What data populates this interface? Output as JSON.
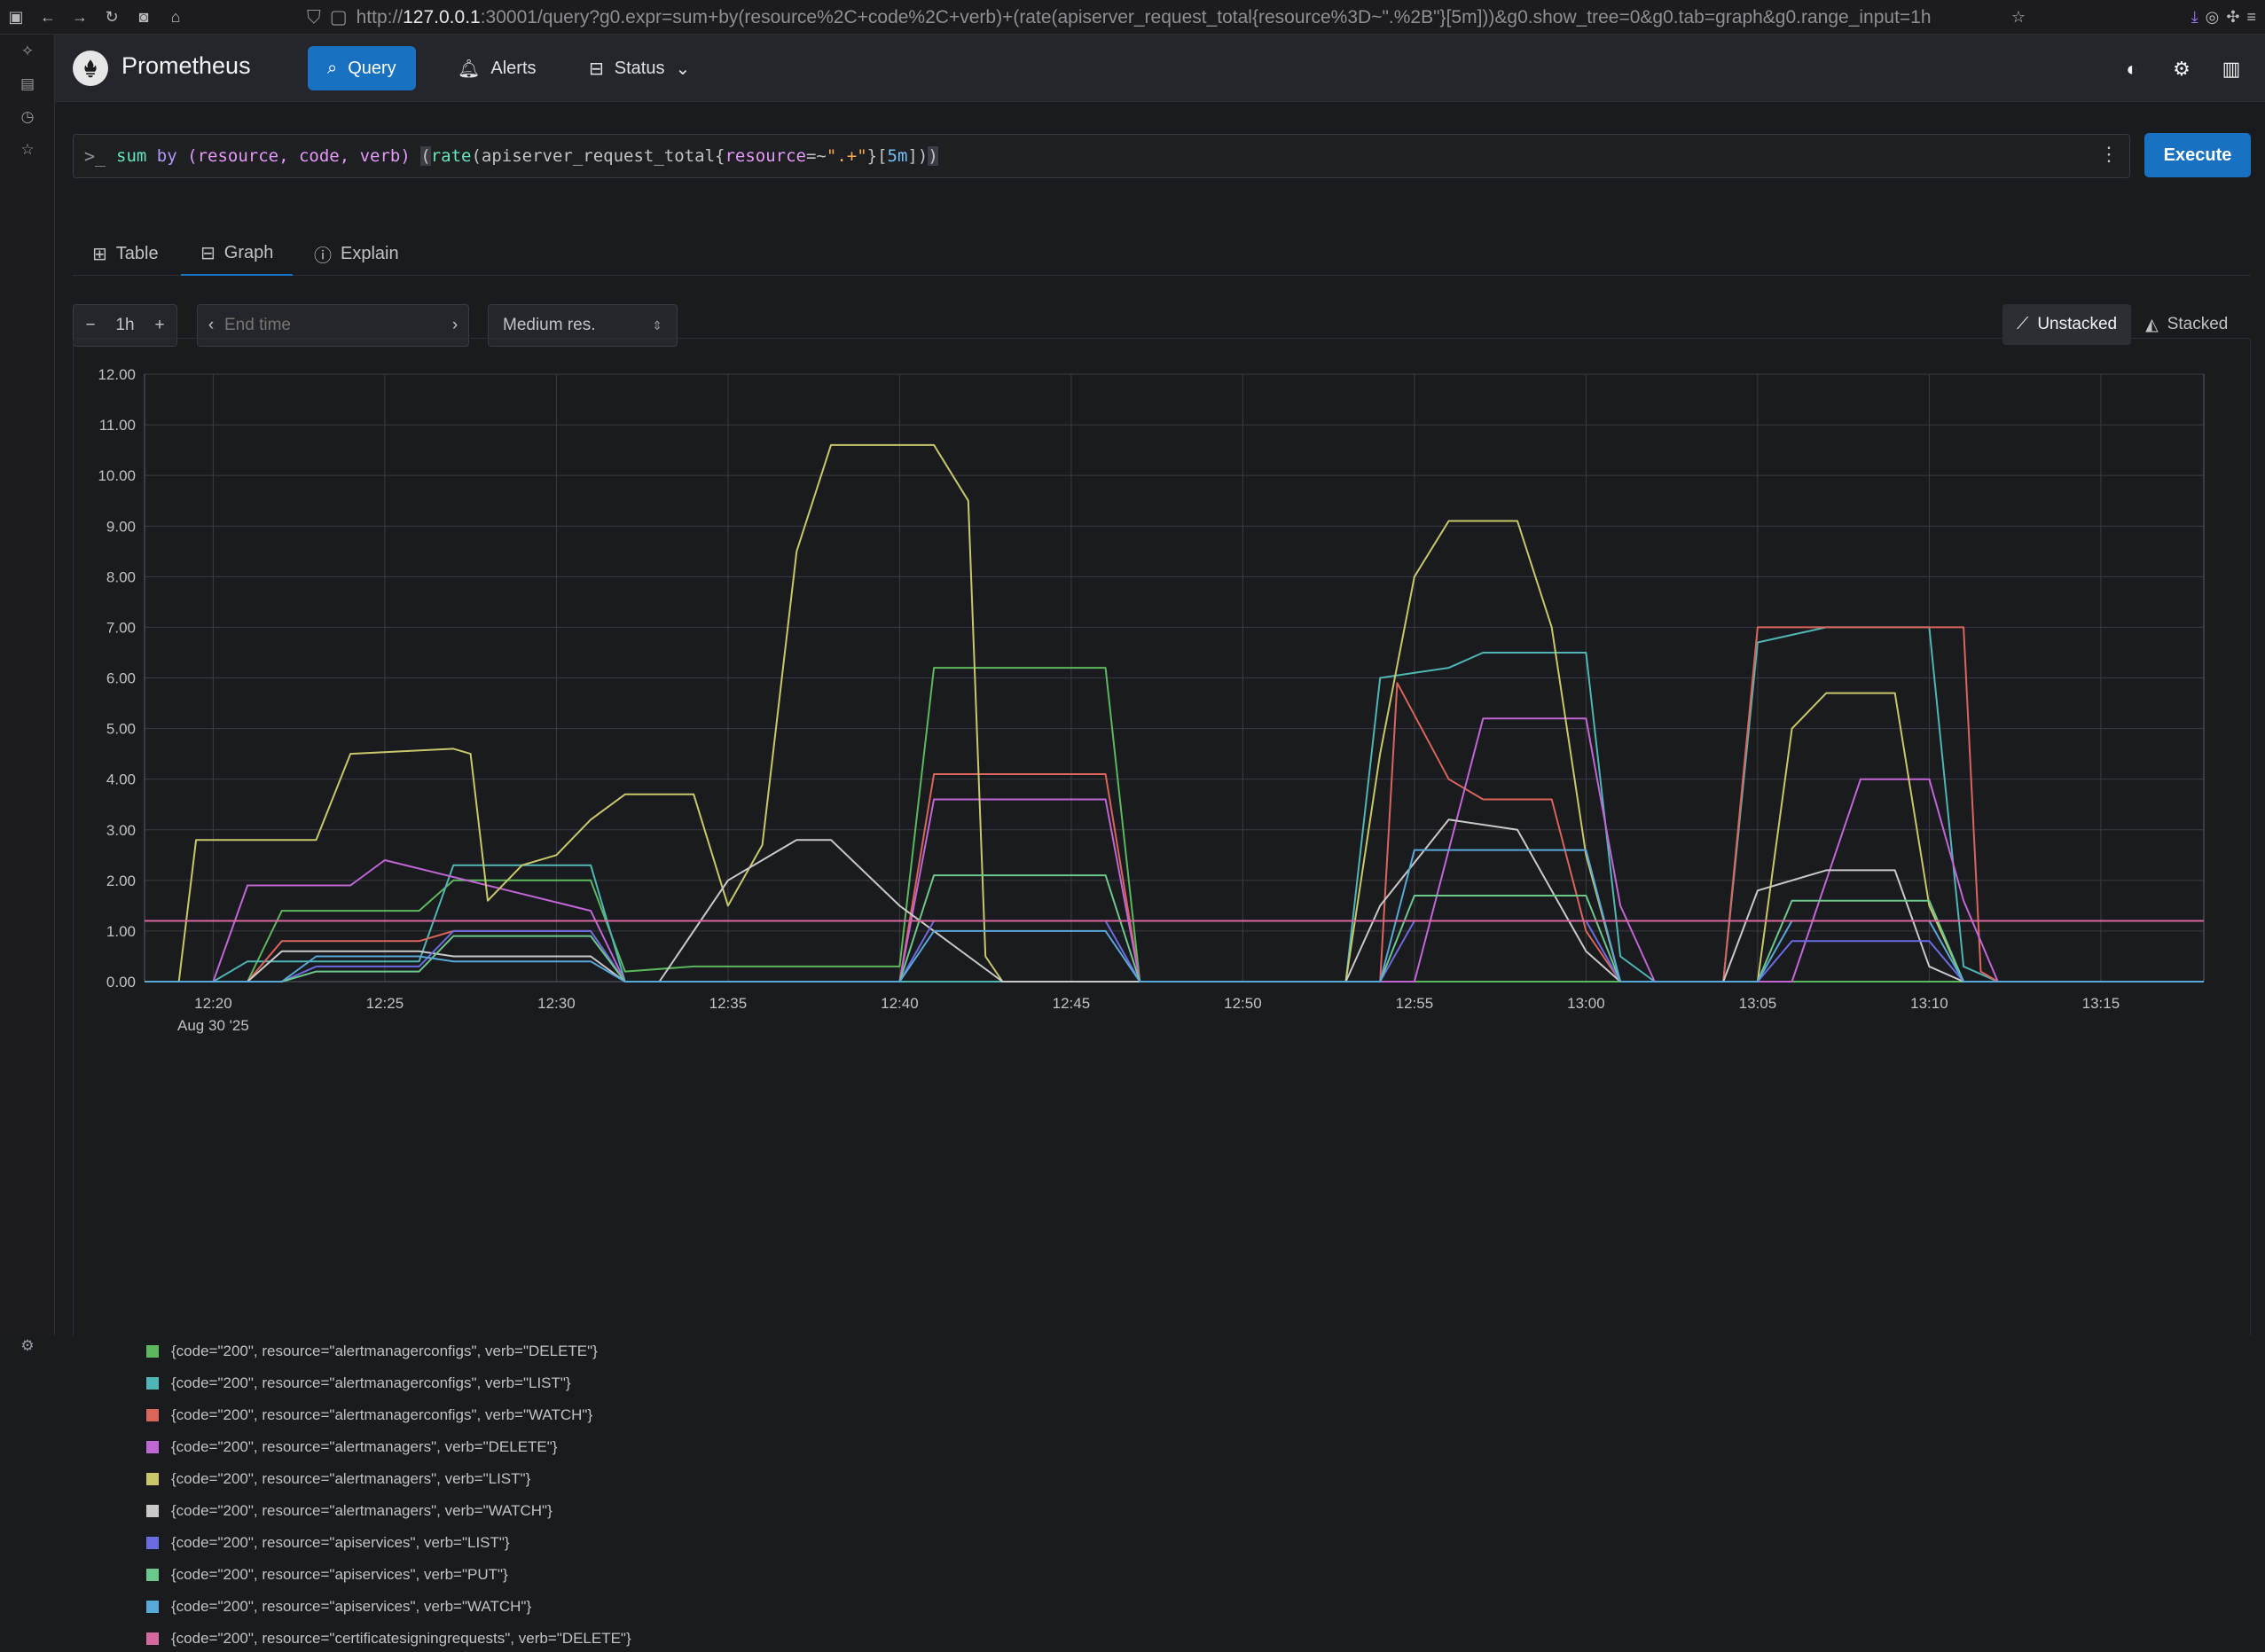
{
  "browser": {
    "url_prefix": "http://",
    "url_host": "127.0.0.1",
    "url_rest": ":30001/query?g0.expr=sum+by(resource%2C+code%2C+verb)+(rate(apiserver_request_total{resource%3D~\".%2B\"}[5m]))&g0.show_tree=0&g0.tab=graph&g0.range_input=1h"
  },
  "header": {
    "brand": "Prometheus",
    "nav": [
      {
        "label": "Query",
        "icon": "search-icon"
      },
      {
        "label": "Alerts",
        "icon": "bell-icon"
      },
      {
        "label": "Status",
        "icon": "server-icon"
      }
    ]
  },
  "query": {
    "fn_sum": "sum",
    "kw_by": "by",
    "labels": "(resource, code, verb) ",
    "fn_rate": "rate",
    "metric": "apiserver_request_total",
    "matcher_label": "resource",
    "matcher_op": "=~",
    "matcher_value": "\".+\"",
    "range": "5m",
    "execute_label": "Execute"
  },
  "tabs": [
    {
      "label": "Table",
      "icon": "table-icon"
    },
    {
      "label": "Graph",
      "icon": "graph-icon"
    },
    {
      "label": "Explain",
      "icon": "info-icon"
    }
  ],
  "controls": {
    "range_value": "1h",
    "end_time_placeholder": "End time",
    "resolution": "Medium res.",
    "unstacked_label": "Unstacked",
    "stacked_label": "Stacked"
  },
  "chart_data": {
    "type": "line",
    "date_label": "Aug 30 '25",
    "ylim": [
      0,
      12
    ],
    "y_ticks": [
      "0.00",
      "1.00",
      "2.00",
      "3.00",
      "4.00",
      "5.00",
      "6.00",
      "7.00",
      "8.00",
      "9.00",
      "10.00",
      "11.00",
      "12.00"
    ],
    "x_ticks": [
      "12:20",
      "12:25",
      "12:30",
      "12:35",
      "12:40",
      "12:45",
      "12:50",
      "12:55",
      "13:00",
      "13:05",
      "13:10",
      "13:15"
    ],
    "x_range": [
      "12:18",
      "13:18"
    ],
    "grid": true,
    "series": [
      {
        "name": "{code=\"200\", resource=\"alertmanagerconfigs\", verb=\"DELETE\"}",
        "color": "#5cb85c",
        "points": [
          [
            0,
            0
          ],
          [
            3,
            0
          ],
          [
            4,
            1.4
          ],
          [
            8,
            1.4
          ],
          [
            9,
            2.0
          ],
          [
            13,
            2.0
          ],
          [
            14,
            0.2
          ],
          [
            16,
            0.3
          ],
          [
            22,
            0.3
          ],
          [
            23,
            6.2
          ],
          [
            28,
            6.2
          ],
          [
            29,
            0
          ],
          [
            60,
            0
          ]
        ]
      },
      {
        "name": "{code=\"200\", resource=\"alertmanagerconfigs\", verb=\"LIST\"}",
        "color": "#4fb5b5",
        "points": [
          [
            0,
            0
          ],
          [
            2,
            0
          ],
          [
            3,
            0.4
          ],
          [
            8,
            0.4
          ],
          [
            9,
            2.3
          ],
          [
            13,
            2.3
          ],
          [
            14,
            0
          ],
          [
            35,
            0
          ],
          [
            36,
            6.0
          ],
          [
            37,
            6.1
          ],
          [
            38,
            6.2
          ],
          [
            39,
            6.5
          ],
          [
            42,
            6.5
          ],
          [
            43,
            0.5
          ],
          [
            44,
            0
          ],
          [
            46,
            0
          ],
          [
            47,
            6.7
          ],
          [
            49,
            7.0
          ],
          [
            52,
            7.0
          ],
          [
            53,
            0.3
          ],
          [
            54,
            0
          ],
          [
            60,
            0
          ]
        ]
      },
      {
        "name": "{code=\"200\", resource=\"alertmanagerconfigs\", verb=\"WATCH\"}",
        "color": "#d9655b",
        "points": [
          [
            0,
            0
          ],
          [
            3,
            0
          ],
          [
            4,
            0.8
          ],
          [
            8,
            0.8
          ],
          [
            9,
            1.0
          ],
          [
            13,
            1.0
          ],
          [
            14,
            0
          ],
          [
            22,
            0
          ],
          [
            23,
            4.1
          ],
          [
            28,
            4.1
          ],
          [
            29,
            0
          ],
          [
            36,
            0
          ],
          [
            36.5,
            5.9
          ],
          [
            38,
            4.0
          ],
          [
            39,
            3.6
          ],
          [
            41,
            3.6
          ],
          [
            42,
            1.0
          ],
          [
            43,
            0
          ],
          [
            46,
            0
          ],
          [
            47,
            7.0
          ],
          [
            53,
            7.0
          ],
          [
            53.5,
            0.2
          ],
          [
            54,
            0
          ],
          [
            60,
            0
          ]
        ]
      },
      {
        "name": "{code=\"200\", resource=\"alertmanagers\", verb=\"DELETE\"}",
        "color": "#c266d6",
        "points": [
          [
            0,
            0
          ],
          [
            2,
            0
          ],
          [
            3,
            1.9
          ],
          [
            6,
            1.9
          ],
          [
            7,
            2.4
          ],
          [
            13,
            1.4
          ],
          [
            14,
            0
          ],
          [
            22,
            0
          ],
          [
            23,
            3.6
          ],
          [
            28,
            3.6
          ],
          [
            29,
            0
          ],
          [
            37,
            0
          ],
          [
            39,
            5.2
          ],
          [
            42,
            5.2
          ],
          [
            43,
            1.5
          ],
          [
            44,
            0
          ],
          [
            48,
            0
          ],
          [
            50,
            4.0
          ],
          [
            52,
            4.0
          ],
          [
            53,
            1.6
          ],
          [
            54,
            0
          ],
          [
            60,
            0
          ]
        ]
      },
      {
        "name": "{code=\"200\", resource=\"alertmanagers\", verb=\"LIST\"}",
        "color": "#c8c86b",
        "points": [
          [
            0,
            0
          ],
          [
            1,
            0
          ],
          [
            1.5,
            2.8
          ],
          [
            5,
            2.8
          ],
          [
            6,
            4.5
          ],
          [
            9,
            4.6
          ],
          [
            9.5,
            4.5
          ],
          [
            10,
            1.6
          ],
          [
            11,
            2.3
          ],
          [
            12,
            2.5
          ],
          [
            13,
            3.2
          ],
          [
            14,
            3.7
          ],
          [
            16,
            3.7
          ],
          [
            17,
            1.5
          ],
          [
            18,
            2.7
          ],
          [
            19,
            8.5
          ],
          [
            20,
            10.6
          ],
          [
            23,
            10.6
          ],
          [
            24,
            9.5
          ],
          [
            24.5,
            0.5
          ],
          [
            25,
            0
          ],
          [
            35,
            0
          ],
          [
            36,
            4.5
          ],
          [
            37,
            8.0
          ],
          [
            38,
            9.1
          ],
          [
            40,
            9.1
          ],
          [
            41,
            7.0
          ],
          [
            42,
            2.5
          ],
          [
            43,
            0
          ],
          [
            47,
            0
          ],
          [
            48,
            5.0
          ],
          [
            49,
            5.7
          ],
          [
            51,
            5.7
          ],
          [
            52,
            1.5
          ],
          [
            53,
            0
          ],
          [
            60,
            0
          ]
        ]
      },
      {
        "name": "{code=\"200\", resource=\"alertmanagers\", verb=\"WATCH\"}",
        "color": "#c9c9c9",
        "points": [
          [
            0,
            0
          ],
          [
            3,
            0
          ],
          [
            4,
            0.6
          ],
          [
            8,
            0.6
          ],
          [
            9,
            0.5
          ],
          [
            13,
            0.5
          ],
          [
            14,
            0
          ],
          [
            15,
            0
          ],
          [
            17,
            2.0
          ],
          [
            19,
            2.8
          ],
          [
            20,
            2.8
          ],
          [
            22,
            1.5
          ],
          [
            25,
            0
          ],
          [
            35,
            0
          ],
          [
            36,
            1.5
          ],
          [
            38,
            3.2
          ],
          [
            40,
            3.0
          ],
          [
            42,
            0.6
          ],
          [
            43,
            0
          ],
          [
            46,
            0
          ],
          [
            47,
            1.8
          ],
          [
            49,
            2.2
          ],
          [
            51,
            2.2
          ],
          [
            52,
            0.3
          ],
          [
            53,
            0
          ],
          [
            60,
            0
          ]
        ]
      },
      {
        "name": "{code=\"200\", resource=\"apiservices\", verb=\"LIST\"}",
        "color": "#6b6be0",
        "points": [
          [
            0,
            0
          ],
          [
            4,
            0
          ],
          [
            5,
            0.3
          ],
          [
            8,
            0.3
          ],
          [
            9,
            1.0
          ],
          [
            13,
            1.0
          ],
          [
            14,
            0
          ],
          [
            22,
            0
          ],
          [
            23,
            1.2
          ],
          [
            28,
            1.2
          ],
          [
            29,
            0
          ],
          [
            36,
            0
          ],
          [
            37,
            1.2
          ],
          [
            42,
            1.2
          ],
          [
            43,
            0
          ],
          [
            47,
            0
          ],
          [
            48,
            0.8
          ],
          [
            52,
            0.8
          ],
          [
            53,
            0
          ],
          [
            60,
            0
          ]
        ]
      },
      {
        "name": "{code=\"200\", resource=\"apiservices\", verb=\"PUT\"}",
        "color": "#6cc78b",
        "points": [
          [
            0,
            0
          ],
          [
            4,
            0
          ],
          [
            5,
            0.2
          ],
          [
            8,
            0.2
          ],
          [
            9,
            0.9
          ],
          [
            13,
            0.9
          ],
          [
            14,
            0
          ],
          [
            22,
            0
          ],
          [
            23,
            2.1
          ],
          [
            28,
            2.1
          ],
          [
            29,
            0
          ],
          [
            36,
            0
          ],
          [
            37,
            1.7
          ],
          [
            42,
            1.7
          ],
          [
            43,
            0
          ],
          [
            47,
            0
          ],
          [
            48,
            1.6
          ],
          [
            52,
            1.6
          ],
          [
            53,
            0
          ],
          [
            60,
            0
          ]
        ]
      },
      {
        "name": "{code=\"200\", resource=\"apiservices\", verb=\"WATCH\"}",
        "color": "#58a8d8",
        "points": [
          [
            0,
            0
          ],
          [
            4,
            0
          ],
          [
            5,
            0.5
          ],
          [
            8,
            0.5
          ],
          [
            9,
            0.4
          ],
          [
            13,
            0.4
          ],
          [
            14,
            0
          ],
          [
            22,
            0
          ],
          [
            23,
            1.0
          ],
          [
            28,
            1.0
          ],
          [
            29,
            0
          ],
          [
            36,
            0
          ],
          [
            37,
            2.6
          ],
          [
            42,
            2.6
          ],
          [
            43,
            0
          ],
          [
            47,
            0
          ],
          [
            48,
            1.2
          ],
          [
            52,
            1.2
          ],
          [
            53,
            0
          ],
          [
            60,
            0
          ]
        ]
      },
      {
        "name": "{code=\"200\", resource=\"certificatesigningrequests\", verb=\"DELETE\"}",
        "color": "#d668a0",
        "points": [
          [
            0,
            1.2
          ],
          [
            60,
            1.2
          ]
        ]
      }
    ]
  }
}
